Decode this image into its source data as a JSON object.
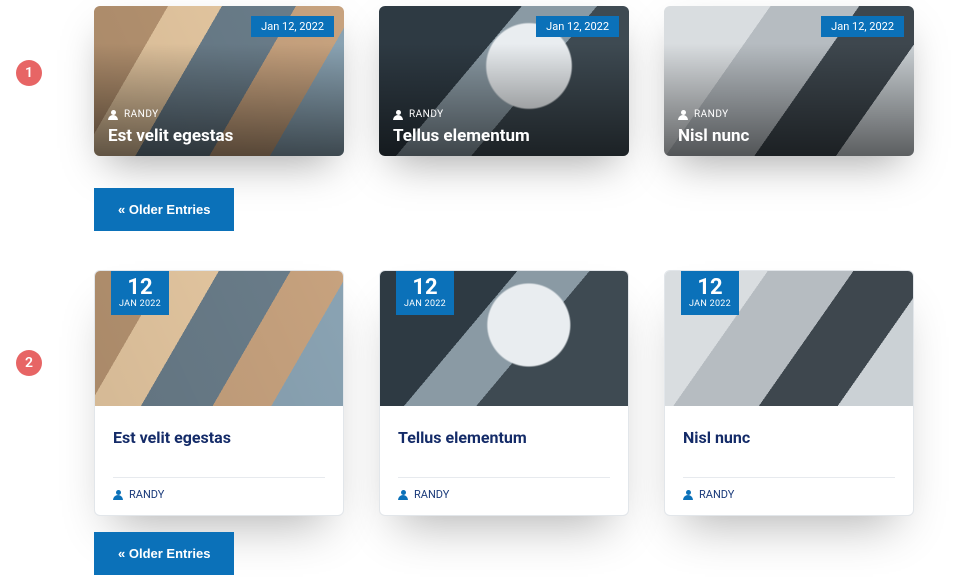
{
  "sections": {
    "one": {
      "badge": "1"
    },
    "two": {
      "badge": "2"
    }
  },
  "cards_v1": [
    {
      "date": "Jan 12, 2022",
      "author": "RANDY",
      "title": "Est velit egestas",
      "img": "cafe"
    },
    {
      "date": "Jan 12, 2022",
      "author": "RANDY",
      "title": "Tellus elementum",
      "img": "notebook"
    },
    {
      "date": "Jan 12, 2022",
      "author": "RANDY",
      "title": "Nisl nunc",
      "img": "laptop"
    }
  ],
  "cards_v2": [
    {
      "day": "12",
      "mon": "JAN 2022",
      "author": "RANDY",
      "title": "Est velit egestas",
      "img": "cafe"
    },
    {
      "day": "12",
      "mon": "JAN 2022",
      "author": "RANDY",
      "title": "Tellus elementum",
      "img": "notebook"
    },
    {
      "day": "12",
      "mon": "JAN 2022",
      "author": "RANDY",
      "title": "Nisl nunc",
      "img": "laptop"
    }
  ],
  "buttons": {
    "older1": "« Older Entries",
    "older2": "« Older Entries"
  }
}
